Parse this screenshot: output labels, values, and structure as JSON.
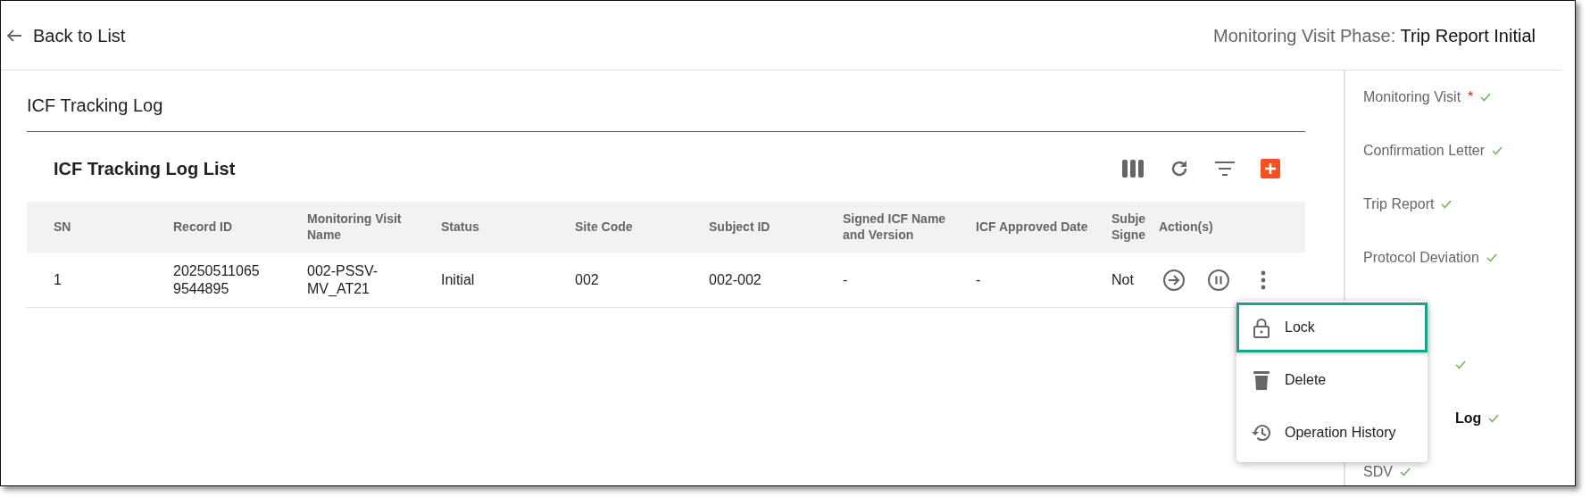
{
  "header": {
    "back_label": "Back to List",
    "phase_label": "Monitoring Visit Phase:",
    "phase_value": "Trip Report Initial"
  },
  "section_title": "ICF Tracking Log",
  "list": {
    "title": "ICF Tracking Log List",
    "toolbar": [
      {
        "kind": "columns"
      },
      {
        "kind": "refresh"
      },
      {
        "kind": "filter"
      },
      {
        "kind": "add"
      }
    ],
    "columns": [
      "SN",
      "Record ID",
      "Monitoring Visit Name",
      "Status",
      "Site Code",
      "Subject ID",
      "Signed ICF Name and Version",
      "ICF Approved Date",
      "Subje Signe",
      "Action(s)"
    ],
    "rows": [
      {
        "cells": [
          "1",
          "20250511065 9544895",
          "002-PSSV- MV_AT21",
          "Initial",
          "002",
          "002-002",
          "-",
          "-",
          "Not"
        ],
        "actions": [
          {
            "kind": "open"
          },
          {
            "kind": "pause"
          },
          {
            "kind": "more"
          }
        ]
      }
    ]
  },
  "menu": {
    "items": [
      {
        "kind": "lock",
        "label": "Lock",
        "selected": true
      },
      {
        "kind": "delete",
        "label": "Delete",
        "selected": false
      },
      {
        "kind": "history",
        "label": "Operation History",
        "selected": false
      }
    ]
  },
  "sidebar": {
    "items": [
      {
        "label": "Monitoring Visit",
        "required_mark": "*",
        "done": true,
        "selected": false
      },
      {
        "label": "Confirmation Letter",
        "done": true,
        "selected": false
      },
      {
        "label": "Trip Report",
        "done": true,
        "selected": false
      },
      {
        "label": "Protocol Deviation",
        "done": true,
        "selected": false
      },
      {
        "done": true,
        "selected": false
      },
      {
        "label": "Log",
        "done": true,
        "selected": true
      },
      {
        "label": "SDV",
        "done": true,
        "selected": false
      }
    ]
  }
}
